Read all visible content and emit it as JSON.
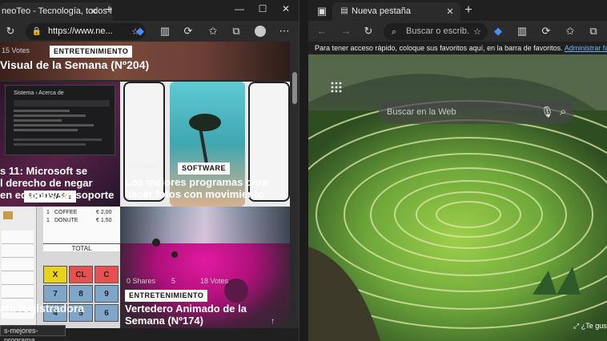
{
  "left_window": {
    "tab_title": "neoTeo - Tecnología, todos los c",
    "address": "https://www.ne...",
    "page": {
      "top_card": {
        "votes": "15 Votes",
        "category": "ENTRETENIMIENTO",
        "headline": "Visual de la Semana (Nº204)"
      },
      "card_windows": {
        "category": "SOFTWARE",
        "headline_line1": "s 11: Microsoft se",
        "headline_line2": "l derecho de negar",
        "headline_line3": "en equipos sin soporte",
        "screen_title": "Sistema › Acerca de"
      },
      "card_photos": {
        "shares": "0 Shares",
        "category": "SOFTWARE",
        "headline_line1": "Los mejores programas para",
        "headline_line2": "hacer fotos con movimiento"
      },
      "card_register": {
        "headline": "aja registradora",
        "receipt_rows": [
          {
            "qty": "1",
            "item": "COFFEE",
            "price": "€ 2,00"
          },
          {
            "qty": "1",
            "item": "DONUTE",
            "price": "€ 1,50"
          }
        ],
        "total_label": "TOTAL",
        "keys": [
          "X",
          "CL",
          "C",
          "7",
          "8",
          "9",
          "4",
          "5",
          "6"
        ]
      },
      "card_art": {
        "shares": "0 Shares",
        "comments": "5",
        "votes": "18 Votes",
        "category": "ENTRETENIMIENTO",
        "headline_line1": "Vertedero Animado de la",
        "headline_line2": "Semana (Nº174)"
      },
      "status_url": "s-mejores-programa..."
    }
  },
  "right_window": {
    "tab_title": "Nueva pestaña",
    "address_placeholder": "Buscar o escrib...",
    "favorites_bar_text": "Para tener acceso rápido, coloque sus favoritos aquí, en la barra de favoritos.",
    "favorites_link": "Administrar favoritos ahora",
    "search_placeholder": "Buscar en la Web",
    "bottom_link": "¿Te gusta"
  }
}
